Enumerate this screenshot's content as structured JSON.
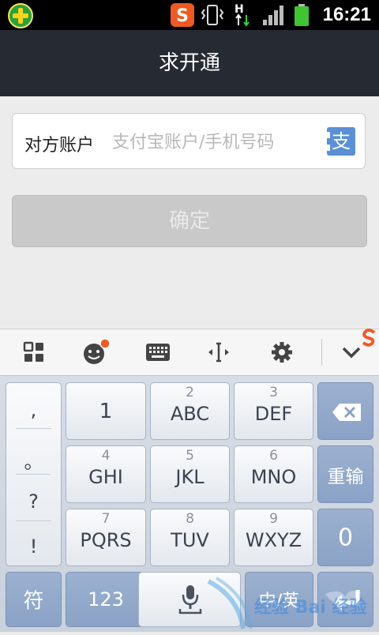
{
  "status_bar": {
    "time": "16:21",
    "icons": [
      "app-plus-icon",
      "sogou-s-icon",
      "vibrate-icon",
      "data-arrows-icon",
      "signal-icon",
      "battery-icon"
    ],
    "network_letter": "H",
    "sogou_letter": "S"
  },
  "title": "求开通",
  "form": {
    "account_label": "对方账户",
    "account_placeholder": "支付宝账户/手机号码",
    "contact_icon_text": "支",
    "confirm_label": "确定"
  },
  "toolbar": {
    "items": [
      "grid-icon",
      "emoji-icon",
      "keyboard-icon",
      "cursor-icon",
      "settings-icon",
      "chevron-down-icon"
    ]
  },
  "keyboard": {
    "punctuation": [
      ",",
      "。",
      "?",
      "!"
    ],
    "rows": [
      [
        {
          "num": "",
          "main": "1"
        },
        {
          "num": "2",
          "main": "ABC"
        },
        {
          "num": "3",
          "main": "DEF"
        }
      ],
      [
        {
          "num": "4",
          "main": "GHI"
        },
        {
          "num": "5",
          "main": "JKL"
        },
        {
          "num": "6",
          "main": "MNO"
        }
      ],
      [
        {
          "num": "7",
          "main": "PQRS"
        },
        {
          "num": "8",
          "main": "TUV"
        },
        {
          "num": "9",
          "main": "WXYZ"
        }
      ]
    ],
    "reinput": "重输",
    "zero": "0",
    "symbol": "符",
    "numeric": "123",
    "chinese": "中/英"
  },
  "colors": {
    "title_bar": "#262a33",
    "accent_blue": "#5b8fd6",
    "dark_key": "#8aa2c6",
    "sogou_orange": "#f05a22"
  }
}
